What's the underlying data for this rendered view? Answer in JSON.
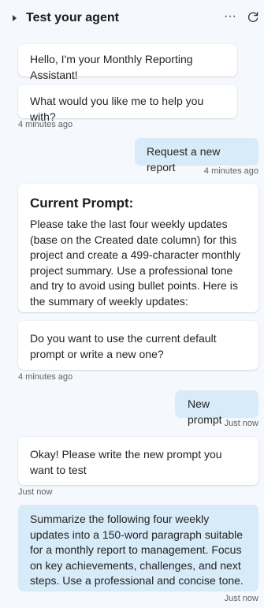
{
  "header": {
    "title": "Test your agent",
    "more_glyph": "···",
    "caret_icon": "caret-right-icon",
    "refresh_icon": "refresh-icon"
  },
  "messages": {
    "bot_greeting": "Hello, I'm your Monthly Reporting Assistant!",
    "bot_help": "What would you like me to help you with?",
    "ts_1": "4 minutes ago",
    "user_request": "Request a new report",
    "ts_2": "4 minutes ago",
    "prompt_title": "Current Prompt:",
    "prompt_body": "Please take the last four weekly updates (base on the Created date column) for this project and create a 499-character monthly project summary. Use a professional tone and try to avoid using bullet points. Here is the summary of weekly updates:",
    "bot_question": "Do you want to use the current default prompt or write a new one?",
    "ts_3": "4 minutes ago",
    "user_new_prompt": "New prompt",
    "ts_4": "Just now",
    "bot_write": "Okay! Please write the new prompt you want to test",
    "ts_5": "Just now",
    "user_summarize": "Summarize the following four weekly updates into a 150-word paragraph suitable for a monthly report to management. Focus on key achievements, challenges, and next steps. Use a professional and concise tone.",
    "ts_6": "Just now"
  },
  "colors": {
    "background": "#f5f8fc",
    "user_bubble": "#d8ebf8",
    "bot_bubble": "#ffffff"
  }
}
